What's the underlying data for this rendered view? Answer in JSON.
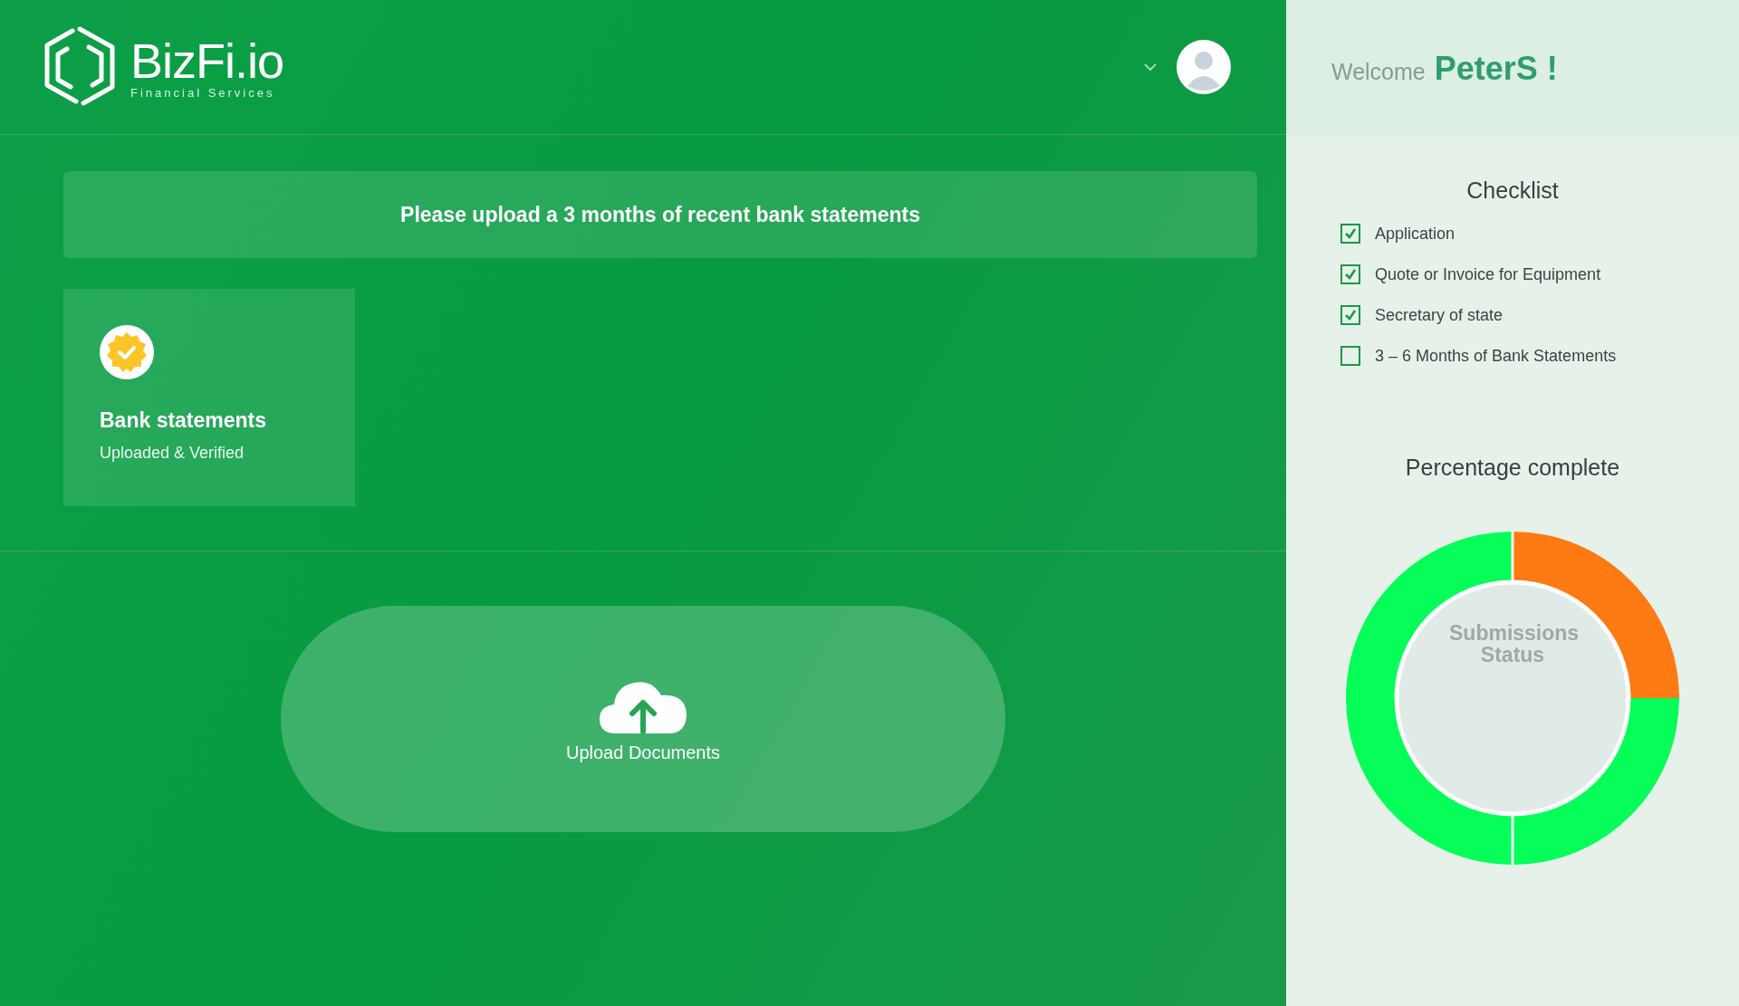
{
  "header": {
    "logo": {
      "name": "BizFi.io",
      "tagline": "Financial Services"
    }
  },
  "banner": {
    "text": "Please upload a 3 months of recent bank statements"
  },
  "documents": [
    {
      "title": "Bank statements",
      "status": "Uploaded & Verified",
      "verified": true
    }
  ],
  "upload_button": {
    "label": "Upload Documents"
  },
  "sidebar": {
    "welcome": "Welcome",
    "username": "PeterS !",
    "checklist": {
      "title": "Checklist",
      "items": [
        {
          "label": "Application",
          "checked": true
        },
        {
          "label": "Quote or Invoice for Equipment",
          "checked": true
        },
        {
          "label": "Secretary of state",
          "checked": true
        },
        {
          "label": "3 – 6 Months of Bank Statements",
          "checked": false
        }
      ]
    },
    "progress": {
      "title": "Percentage complete",
      "center_label": "Submissions Status"
    }
  }
}
